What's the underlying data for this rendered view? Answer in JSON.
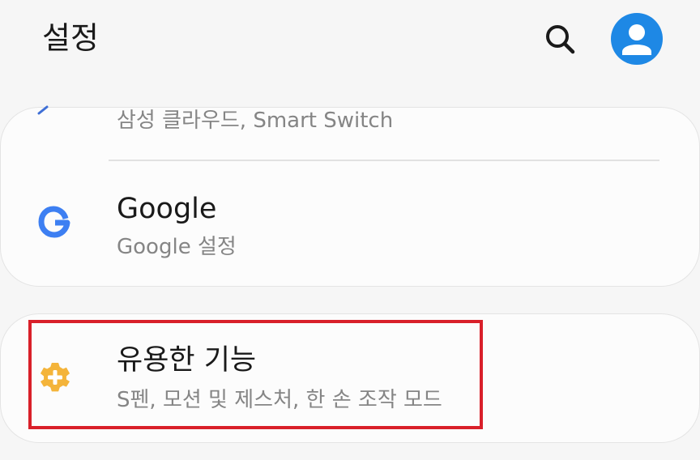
{
  "header": {
    "title": "설정",
    "search_icon": "search-icon",
    "avatar_icon": "account-avatar-icon",
    "avatar_color": "#1e88e5"
  },
  "settings": {
    "previous_item": {
      "subtitle": "삼성 클라우드, Smart Switch",
      "icon": "cloud-icon"
    },
    "google": {
      "title": "Google",
      "subtitle": "Google 설정",
      "icon": "google-icon"
    },
    "useful_features": {
      "title": "유용한 기능",
      "subtitle": "S펜, 모션 및 제스처, 한 손 조작 모드",
      "icon": "gear-plus-icon",
      "icon_color": "#f4b43a",
      "highlighted": true,
      "highlight_color": "#d9202a"
    }
  }
}
